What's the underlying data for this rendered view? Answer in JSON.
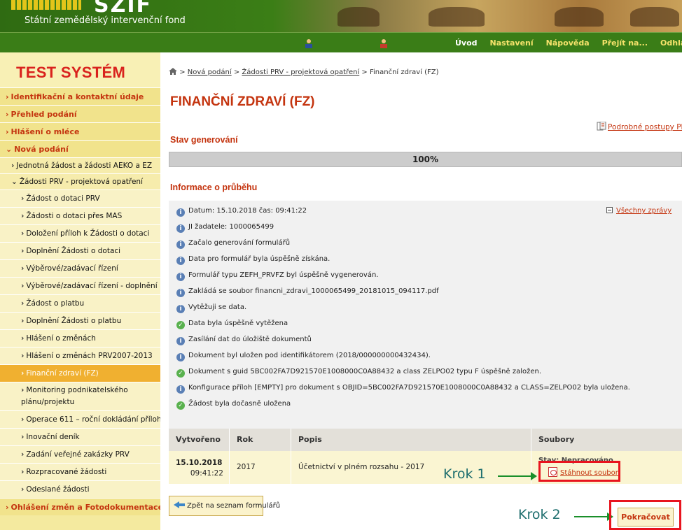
{
  "header": {
    "logo_text": "SZIF",
    "subtitle": "Státní zemědělský intervenční fond"
  },
  "topnav": {
    "icons": [
      "user-icon",
      "user-icon"
    ],
    "links": [
      "Úvod",
      "Nastavení",
      "Nápověda",
      "Přejít na...",
      "Odhlásit"
    ]
  },
  "sidebar": {
    "brand": "TEST SYSTÉM",
    "level1_top": [
      "Identifikační a kontaktní údaje",
      "Přehled podání",
      "Hlášení o mléce",
      "Nová podání"
    ],
    "level2": [
      "Jednotná žádost a žádosti AEKO a EZ",
      "Žádosti PRV - projektová opatření"
    ],
    "level3": [
      "Žádost o dotaci PRV",
      "Žádosti o dotaci přes MAS",
      "Doložení příloh k Žádosti o dotaci",
      "Doplnění Žádosti o dotaci",
      "Výběrové/zadávací řízení",
      "Výběrové/zadávací řízení - doplnění",
      "Žádost o platbu",
      "Doplnění Žádosti o platbu",
      "Hlášení o změnách",
      "Hlášení o změnách PRV2007-2013",
      "Finanční zdraví (FZ)",
      "Monitoring podnikatelského plánu/projektu",
      "Operace 611 – roční dokládání příloh",
      "Inovační deník",
      "Zadání veřejné zakázky PRV",
      "Rozpracované žádosti",
      "Odeslané žádosti"
    ],
    "level1_bottom": "Ohlášení změn a Fotodokumentace"
  },
  "breadcrumb": {
    "items": [
      "Nová podání",
      "Žádosti PRV - projektová opatření"
    ],
    "current": "Finanční zdraví (FZ)",
    "separator": ">"
  },
  "page": {
    "title": "FINANČNÍ ZDRAVÍ (FZ)",
    "help_link": "Podrobné postupy PRV",
    "generation_heading": "Stav generování",
    "progress_percent": 100,
    "progress_label": "100%",
    "info_heading": "Informace o průběhu",
    "all_messages": "Všechny zprávy"
  },
  "log": [
    {
      "type": "info",
      "text": "Datum: 15.10.2018 čas: 09:41:22"
    },
    {
      "type": "info",
      "text": "JI žadatele: 1000065499"
    },
    {
      "type": "info",
      "text": "Začalo generování formulářů"
    },
    {
      "type": "info",
      "text": "Data pro formulář byla úspěšně získána."
    },
    {
      "type": "info",
      "text": "Formulář typu ZEFH_PRVFZ byl úspěšně vygenerován."
    },
    {
      "type": "info",
      "text": "Zakládá se soubor financni_zdravi_1000065499_20181015_094117.pdf"
    },
    {
      "type": "info",
      "text": "Vytěžuji se data."
    },
    {
      "type": "ok",
      "text": "Data byla úspěšně vytěžena"
    },
    {
      "type": "info",
      "text": "Zasílání dat do úložiště dokumentů"
    },
    {
      "type": "info",
      "text": "Dokument byl uložen pod identifikátorem (2018/000000000432434)."
    },
    {
      "type": "ok",
      "text": "Dokument s guid 5BC002FA7D921570E1008000C0A88432 a class ZELPO02 typu F úspěšně založen."
    },
    {
      "type": "info",
      "text": "Konfigurace příloh [EMPTY] pro dokument s OBJID=5BC002FA7D921570E1008000C0A88432 a CLASS=ZELPO02 byla uložena."
    },
    {
      "type": "ok",
      "text": "Žádost byla dočasně uložena"
    }
  ],
  "table": {
    "headers": [
      "Vytvořeno",
      "Rok",
      "Popis",
      "Soubory"
    ],
    "row": {
      "date": "15.10.2018",
      "time": "09:41:22",
      "year": "2017",
      "description": "Účetnictví v plném rozsahu - 2017",
      "file_label": "Stav: Nepracováno",
      "download": "Stáhnout soubor"
    }
  },
  "actions": {
    "back": "Zpět na seznam formulářů",
    "continue": "Pokračovat"
  },
  "annotations": {
    "step1": "Krok 1",
    "step2": "Krok 2",
    "highlight_color": "#e8141e",
    "arrow_color": "#1a8f2a"
  }
}
